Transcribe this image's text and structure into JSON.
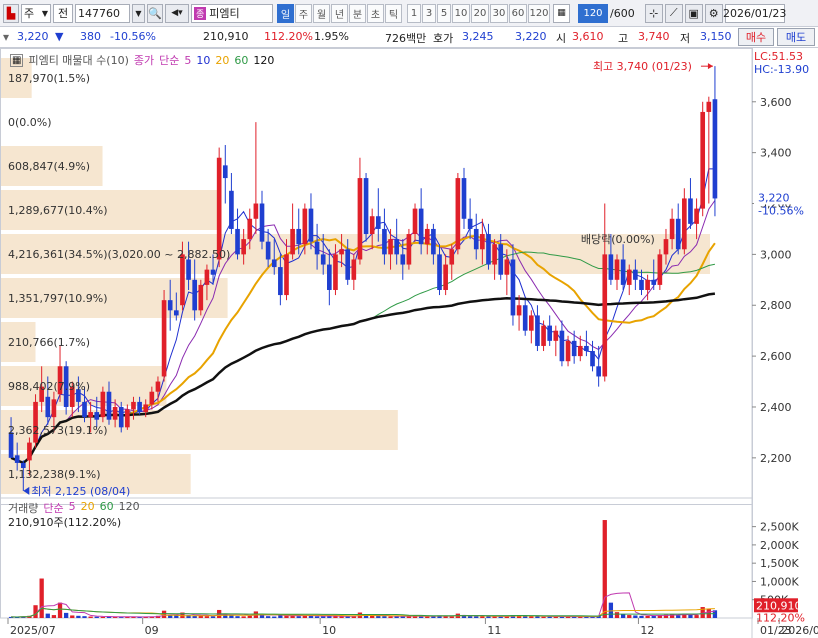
{
  "toolbar": {
    "market": "주",
    "code_type": "전",
    "code": "147760",
    "name_tag": "종",
    "name": "피엠티",
    "periods": [
      "일",
      "주",
      "월",
      "년",
      "분",
      "초",
      "틱"
    ],
    "active_period": "일",
    "minute_options": [
      "1",
      "3",
      "5",
      "10",
      "20",
      "30",
      "60",
      "120"
    ],
    "count_value": "120",
    "count_total": "/600",
    "date": "2026/01/23"
  },
  "quote": {
    "price": "3,220",
    "change_arrow": "▼",
    "change": "380",
    "change_pct": "-10.56%",
    "volume": "210,910",
    "volume_ratio": "112.20%",
    "turnover": "1.95%",
    "amount": "726백만",
    "ask_label": "호가",
    "ask": "3,245",
    "bid": "3,220",
    "open_label": "시",
    "open": "3,610",
    "high_label": "고",
    "high": "3,740",
    "low_label": "저",
    "low": "3,150",
    "buy_label": "매수",
    "sell_label": "매도"
  },
  "price_panel": {
    "legend_name": "피엠티 매물대 수(10)",
    "legend_close": "종가",
    "legend_type": "단순",
    "ma_periods": [
      "5",
      "10",
      "20",
      "60",
      "120"
    ],
    "ma_colors": [
      "#1f2fd0",
      "#1f2fd0",
      "#e8a300",
      "#2f9a46",
      "#111111"
    ],
    "lc": "LC:51.53",
    "hc": "HC:-13.90",
    "current_label": "3,220",
    "current_pct": "-10.56%",
    "high_note": "최고 3,740 (01/23)",
    "low_note": "최저 2,125 (08/04)",
    "dividend_note": "배당락(0.00%)",
    "volume_profile": [
      {
        "label": "187,970(1.5%)",
        "value": 187970
      },
      {
        "label": "0(0.0%)",
        "value": 0
      },
      {
        "label": "608,847(4.9%)",
        "value": 608847
      },
      {
        "label": "1,289,677(10.4%)",
        "value": 1289677
      },
      {
        "label": "4,216,361(34.5%)(3,020.00 ~ 2,882.50)",
        "value": 4216361
      },
      {
        "label": "1,351,797(10.9%)",
        "value": 1351797
      },
      {
        "label": "210,766(1.7%)",
        "value": 210766
      },
      {
        "label": "988,402(7.9%)",
        "value": 988402
      },
      {
        "label": "2,362,573(19.1%)",
        "value": 2362573
      },
      {
        "label": "1,132,238(9.1%)",
        "value": 1132238
      }
    ],
    "y_ticks": [
      "3,600",
      "3,400",
      "3,200",
      "3,000",
      "2,800",
      "2,600",
      "2,400",
      "2,200"
    ]
  },
  "volume_panel": {
    "legend_name": "거래량",
    "legend_type": "단순",
    "ma_periods": [
      "5",
      "20",
      "60",
      "120"
    ],
    "last_value": "210,910주(112.20%)",
    "y_ticks": [
      "2,500K",
      "2,000K",
      "1,500K",
      "1,000K",
      "500K"
    ],
    "current_label": "210,910",
    "current_pct": "112.20%"
  },
  "x_axis": [
    "2025/07",
    "09",
    "10",
    "11",
    "12",
    "2026/01",
    "01/23"
  ],
  "chart_data": {
    "type": "candlestick",
    "title": "",
    "ylim": [
      2050,
      3780
    ],
    "volume_ylim": [
      0,
      2900000
    ],
    "colors": {
      "up": "#e0202a",
      "down": "#1f3fd0",
      "ma5": "#1f2fd0",
      "ma10": "#8a2ab0",
      "ma20": "#e8a300",
      "ma60": "#2f9a46",
      "ma120": "#111111"
    },
    "candles": [
      [
        2300,
        2360,
        2250,
        2200
      ],
      [
        2210,
        2260,
        2150,
        2180
      ],
      [
        2180,
        2190,
        2125,
        2160
      ],
      [
        2190,
        2280,
        2130,
        2260
      ],
      [
        2260,
        2450,
        2240,
        2420
      ],
      [
        2420,
        2560,
        2380,
        2480
      ],
      [
        2440,
        2520,
        2330,
        2360
      ],
      [
        2360,
        2460,
        2300,
        2430
      ],
      [
        2450,
        2640,
        2420,
        2560
      ],
      [
        2560,
        2580,
        2370,
        2400
      ],
      [
        2400,
        2500,
        2360,
        2480
      ],
      [
        2470,
        2520,
        2380,
        2420
      ],
      [
        2420,
        2480,
        2340,
        2360
      ],
      [
        2360,
        2420,
        2300,
        2380
      ],
      [
        2380,
        2440,
        2320,
        2350
      ],
      [
        2360,
        2480,
        2340,
        2460
      ],
      [
        2460,
        2500,
        2330,
        2350
      ],
      [
        2350,
        2430,
        2320,
        2400
      ],
      [
        2400,
        2420,
        2300,
        2320
      ],
      [
        2320,
        2410,
        2310,
        2390
      ],
      [
        2390,
        2440,
        2350,
        2420
      ],
      [
        2420,
        2440,
        2370,
        2380
      ],
      [
        2380,
        2430,
        2360,
        2410
      ],
      [
        2410,
        2480,
        2390,
        2460
      ],
      [
        2460,
        2520,
        2420,
        2500
      ],
      [
        2520,
        2860,
        2500,
        2820
      ],
      [
        2820,
        2900,
        2700,
        2780
      ],
      [
        2780,
        2850,
        2740,
        2760
      ],
      [
        2800,
        3050,
        2780,
        3000
      ],
      [
        2980,
        3050,
        2860,
        2900
      ],
      [
        2900,
        2980,
        2740,
        2780
      ],
      [
        2780,
        2900,
        2760,
        2880
      ],
      [
        2880,
        2960,
        2820,
        2940
      ],
      [
        2940,
        3000,
        2880,
        2920
      ],
      [
        2980,
        3420,
        2950,
        3380
      ],
      [
        3350,
        3430,
        3200,
        3300
      ],
      [
        3250,
        3320,
        3080,
        3100
      ],
      [
        3100,
        3180,
        2980,
        3000
      ],
      [
        3000,
        3100,
        2960,
        3060
      ],
      [
        3060,
        3180,
        3020,
        3140
      ],
      [
        3140,
        3520,
        3080,
        3200
      ],
      [
        3200,
        3250,
        3020,
        3050
      ],
      [
        3050,
        3100,
        2950,
        2980
      ],
      [
        2980,
        3060,
        2920,
        2950
      ],
      [
        2950,
        3000,
        2800,
        2840
      ],
      [
        2840,
        3060,
        2820,
        3000
      ],
      [
        3000,
        3200,
        2980,
        3100
      ],
      [
        3100,
        3180,
        3000,
        3040
      ],
      [
        3040,
        3200,
        3000,
        3180
      ],
      [
        3180,
        3240,
        3020,
        3050
      ],
      [
        3050,
        3120,
        2940,
        3000
      ],
      [
        3000,
        3080,
        2920,
        2960
      ],
      [
        2960,
        3020,
        2800,
        2860
      ],
      [
        2860,
        3040,
        2840,
        3000
      ],
      [
        3000,
        3080,
        2950,
        3020
      ],
      [
        3020,
        3060,
        2880,
        2900
      ],
      [
        2900,
        3000,
        2860,
        2980
      ],
      [
        2980,
        3380,
        2960,
        3300
      ],
      [
        3300,
        3320,
        3050,
        3080
      ],
      [
        3080,
        3180,
        3020,
        3150
      ],
      [
        3150,
        3260,
        3050,
        3100
      ],
      [
        3100,
        3180,
        2960,
        3000
      ],
      [
        3000,
        3100,
        2940,
        3060
      ],
      [
        3060,
        3140,
        2960,
        3000
      ],
      [
        3000,
        3060,
        2900,
        2960
      ],
      [
        2960,
        3100,
        2940,
        3080
      ],
      [
        3080,
        3200,
        3050,
        3180
      ],
      [
        3180,
        3260,
        3000,
        3040
      ],
      [
        3040,
        3120,
        3000,
        3100
      ],
      [
        3100,
        3120,
        2960,
        3000
      ],
      [
        3000,
        3040,
        2840,
        2860
      ],
      [
        2860,
        3000,
        2840,
        2960
      ],
      [
        2960,
        3040,
        2900,
        3020
      ],
      [
        3020,
        3320,
        3000,
        3300
      ],
      [
        3300,
        3340,
        3100,
        3140
      ],
      [
        3140,
        3220,
        3060,
        3100
      ],
      [
        3100,
        3160,
        2980,
        3020
      ],
      [
        3020,
        3140,
        2960,
        3080
      ],
      [
        3080,
        3120,
        2940,
        2960
      ],
      [
        2960,
        3060,
        2900,
        3040
      ],
      [
        3040,
        3080,
        2900,
        2920
      ],
      [
        2920,
        3020,
        2840,
        2980
      ],
      [
        2980,
        3040,
        2720,
        2760
      ],
      [
        2760,
        2840,
        2700,
        2800
      ],
      [
        2800,
        2820,
        2680,
        2700
      ],
      [
        2700,
        2780,
        2650,
        2760
      ],
      [
        2760,
        2800,
        2620,
        2640
      ],
      [
        2640,
        2740,
        2620,
        2720
      ],
      [
        2720,
        2760,
        2640,
        2660
      ],
      [
        2660,
        2720,
        2600,
        2700
      ],
      [
        2700,
        2740,
        2560,
        2580
      ],
      [
        2580,
        2680,
        2560,
        2660
      ],
      [
        2660,
        2700,
        2570,
        2600
      ],
      [
        2600,
        2680,
        2580,
        2640
      ],
      [
        2640,
        2700,
        2600,
        2620
      ],
      [
        2620,
        2660,
        2540,
        2560
      ],
      [
        2560,
        2640,
        2480,
        2520
      ],
      [
        2520,
        3200,
        2500,
        3000
      ],
      [
        3000,
        3080,
        2880,
        2900
      ],
      [
        2900,
        3000,
        2860,
        2980
      ],
      [
        2980,
        3040,
        2860,
        2880
      ],
      [
        2880,
        2960,
        2840,
        2940
      ],
      [
        2940,
        2980,
        2860,
        2900
      ],
      [
        2900,
        2940,
        2840,
        2860
      ],
      [
        2860,
        2920,
        2820,
        2900
      ],
      [
        2900,
        2980,
        2860,
        2880
      ],
      [
        2880,
        3020,
        2860,
        3000
      ],
      [
        3000,
        3100,
        2960,
        3060
      ],
      [
        3060,
        3180,
        3020,
        3140
      ],
      [
        3140,
        3200,
        3000,
        3020
      ],
      [
        3020,
        3260,
        3000,
        3220
      ],
      [
        3220,
        3300,
        3100,
        3120
      ],
      [
        3120,
        3220,
        3060,
        3180
      ],
      [
        3180,
        3600,
        3150,
        3560
      ],
      [
        3560,
        3620,
        3200,
        3600
      ],
      [
        3610,
        3740,
        3150,
        3220
      ]
    ],
    "volumes": [
      30000,
      25000,
      40000,
      60000,
      350000,
      1080000,
      120000,
      80000,
      420000,
      140000,
      70000,
      60000,
      50000,
      40000,
      35000,
      30000,
      45000,
      30000,
      25000,
      30000,
      35000,
      30000,
      28000,
      40000,
      60000,
      200000,
      90000,
      70000,
      150000,
      80000,
      60000,
      55000,
      50000,
      45000,
      220000,
      120000,
      70000,
      50000,
      45000,
      60000,
      180000,
      80000,
      50000,
      40000,
      70000,
      60000,
      90000,
      50000,
      70000,
      60000,
      45000,
      40000,
      70000,
      55000,
      40000,
      45000,
      40000,
      150000,
      80000,
      55000,
      60000,
      50000,
      40000,
      45000,
      50000,
      45000,
      60000,
      50000,
      40000,
      45000,
      70000,
      50000,
      40000,
      120000,
      70000,
      50000,
      45000,
      40000,
      50000,
      45000,
      40000,
      45000,
      80000,
      60000,
      50000,
      40000,
      50000,
      35000,
      40000,
      35000,
      45000,
      40000,
      35000,
      30000,
      35000,
      40000,
      60000,
      2680000,
      420000,
      160000,
      100000,
      80000,
      70000,
      60000,
      55000,
      60000,
      80000,
      90000,
      110000,
      70000,
      120000,
      90000,
      80000,
      300000,
      250000,
      210910
    ]
  }
}
